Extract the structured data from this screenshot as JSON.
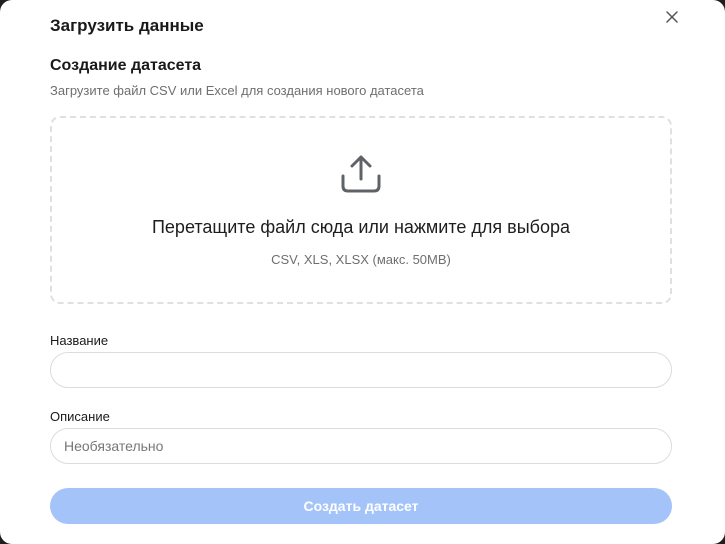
{
  "modal": {
    "title": "Загрузить данные",
    "close_icon": "close-icon"
  },
  "section": {
    "title": "Создание датасета",
    "description": "Загрузите файл CSV или Excel для создания нового датасета"
  },
  "dropzone": {
    "icon": "upload-icon",
    "text": "Перетащите файл сюда или нажмите для выбора",
    "hint": "CSV, XLS, XLSX (макс. 50MB)"
  },
  "form": {
    "name_label": "Название",
    "name_value": "",
    "name_placeholder": "",
    "description_label": "Описание",
    "description_value": "",
    "description_placeholder": "Необязательно"
  },
  "submit": {
    "label": "Создать датасет",
    "disabled": true
  },
  "colors": {
    "button_disabled": "#a4c4f9",
    "dropzone_border": "#e0e0e0",
    "icon": "#5f6368"
  }
}
